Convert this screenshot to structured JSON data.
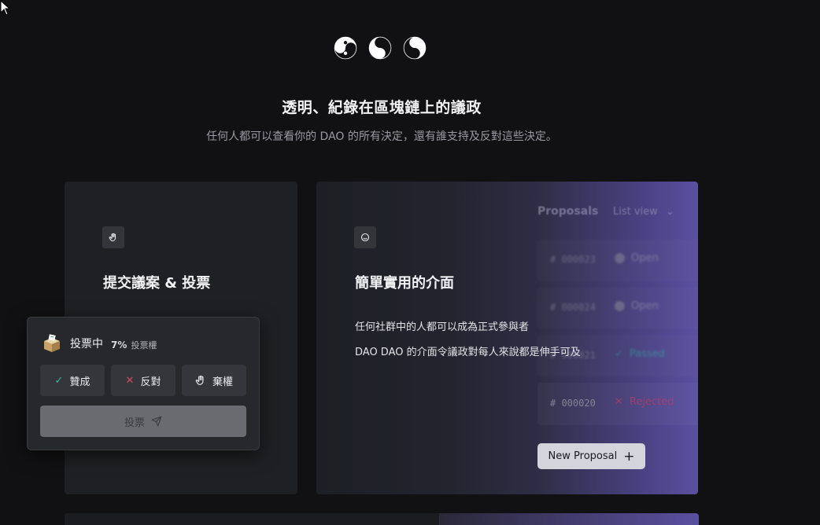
{
  "hero": {
    "headline": "透明、紀錄在區塊鏈上的議政",
    "subline": "任何人都可以查看你的 DAO 的所有決定，還有誰支持及反對這些決定。",
    "icons": [
      "yin-yang-icon",
      "yin-yang-icon",
      "yin-yang-icon"
    ]
  },
  "card_left": {
    "icon": "raised-hand-icon",
    "title": "提交議案 & 投票"
  },
  "card_right": {
    "icon": "smiley-icon",
    "title": "簡單實用的介面",
    "line1": "任何社群中的人都可以成為正式參與者",
    "line2": "DAO DAO 的介面令議政對每人來說都是伸手可及",
    "proposals_label": "Proposals",
    "list_view_label": "List view",
    "rows": [
      {
        "id": "# 000023",
        "status": "Open",
        "status_color": "#9a9aa6"
      },
      {
        "id": "# 000024",
        "status": "Open",
        "status_color": "#9a9aa6"
      },
      {
        "id": "# 000021",
        "status": "Passed",
        "status_color": "#2fb8a6"
      },
      {
        "id": "# 000020",
        "status": "Rejected",
        "status_color": "#d0455c"
      }
    ],
    "new_proposal_label": "New Proposal"
  },
  "vote_panel": {
    "icon": "ballot-box-icon",
    "title": "投票中",
    "percent": "7%",
    "vp_label": "投票權",
    "yes_label": "贊成",
    "no_label": "反對",
    "abstain_label": "棄權",
    "submit_label": "投票",
    "colors": {
      "yes": "#3fb59e",
      "no": "#d9485f"
    }
  }
}
